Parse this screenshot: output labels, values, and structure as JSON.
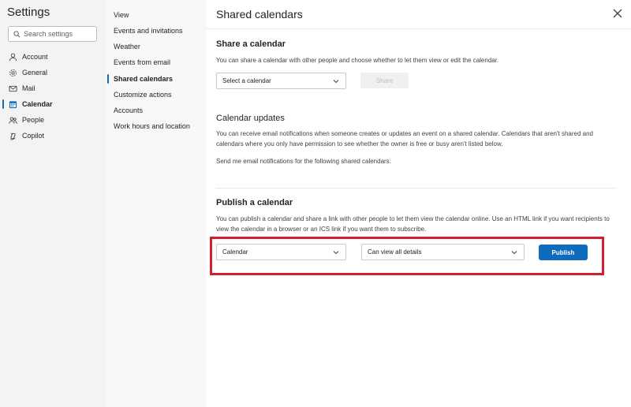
{
  "settings": {
    "title": "Settings",
    "search_placeholder": "Search settings"
  },
  "nav": {
    "items": [
      {
        "label": "Account",
        "icon": "person-icon"
      },
      {
        "label": "General",
        "icon": "gear-icon"
      },
      {
        "label": "Mail",
        "icon": "mail-icon"
      },
      {
        "label": "Calendar",
        "icon": "calendar-icon",
        "active": true
      },
      {
        "label": "People",
        "icon": "people-icon"
      },
      {
        "label": "Copilot",
        "icon": "copilot-icon"
      }
    ]
  },
  "subnav": {
    "items": [
      {
        "label": "View"
      },
      {
        "label": "Events and invitations"
      },
      {
        "label": "Weather"
      },
      {
        "label": "Events from email"
      },
      {
        "label": "Shared calendars",
        "active": true
      },
      {
        "label": "Customize actions"
      },
      {
        "label": "Accounts"
      },
      {
        "label": "Work hours and location"
      }
    ]
  },
  "main": {
    "title": "Shared calendars",
    "share": {
      "heading": "Share a calendar",
      "description": "You can share a calendar with other people and choose whether to let them view or edit the calendar.",
      "select_placeholder": "Select a calendar",
      "button": "Share"
    },
    "updates": {
      "heading": "Calendar updates",
      "description": "You can receive email notifications when someone creates or updates an event on a shared calendar. Calendars that aren't shared and calendars where you only have permission to see whether the owner is free or busy aren't listed below.",
      "notify_label": "Send me email notifications for the following shared calendars:"
    },
    "publish": {
      "heading": "Publish a calendar",
      "description": "You can publish a calendar and share a link with other people to let them view the calendar online. Use an HTML link if you want recipients to view the calendar in a browser or an ICS link if you want them to subscribe.",
      "calendar_select": "Calendar",
      "permission_select": "Can view all details",
      "button": "Publish"
    }
  },
  "colors": {
    "accent": "#0f6cbd",
    "highlight": "#d0202b"
  }
}
